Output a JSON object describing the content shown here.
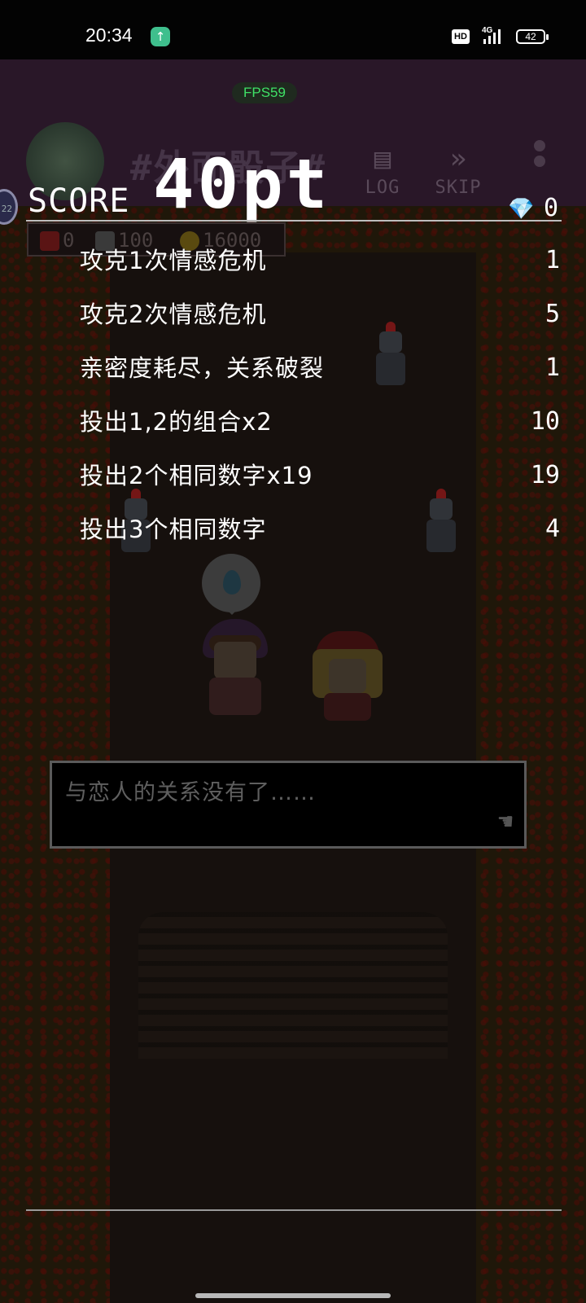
{
  "status_bar": {
    "time": "20:34",
    "upload_icon": "upload-arrow-icon",
    "hd_badge": "HD",
    "network": "4G",
    "battery": "42"
  },
  "game_header": {
    "fps": "FPS59",
    "title": "#外面骰子#",
    "log_label": "LOG",
    "skip_label": "SKIP",
    "skip_icon": "»"
  },
  "stats": {
    "hearts": "0",
    "cards": "100",
    "coins": "16000"
  },
  "score": {
    "label": "SCORE",
    "value": "40pt",
    "gem_count": "0",
    "items": [
      {
        "label": "攻克1次情感危机",
        "value": "1"
      },
      {
        "label": "攻克2次情感危机",
        "value": "5"
      },
      {
        "label": "亲密度耗尽，关系破裂",
        "value": "1"
      },
      {
        "label": "投出1,2的组合x2",
        "value": "10"
      },
      {
        "label": "投出2个相同数字x19",
        "value": "19"
      },
      {
        "label": "投出3个相同数字",
        "value": "4"
      }
    ]
  },
  "dialog": {
    "text": "与恋人的关系没有了……"
  },
  "colors": {
    "header_bg": "#291728",
    "fps_green": "#3fe066",
    "gem_blue": "#7fd0ff"
  }
}
